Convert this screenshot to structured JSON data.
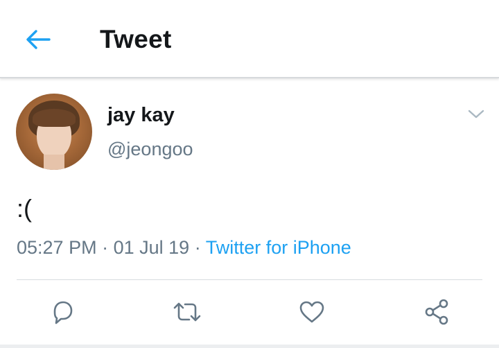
{
  "header": {
    "title": "Tweet",
    "back_icon": "back-arrow-icon"
  },
  "tweet": {
    "user": {
      "name": "jay kay",
      "handle": "@jeongoo",
      "avatar_icon": "profile-photo"
    },
    "more_icon": "chevron-down-icon",
    "text": ":(",
    "time": "05:27 PM",
    "date": "01 Jul 19",
    "separator": "·",
    "source": "Twitter for iPhone"
  },
  "actions": {
    "reply_icon": "reply-icon",
    "retweet_icon": "retweet-icon",
    "like_icon": "heart-icon",
    "share_icon": "share-icon"
  },
  "colors": {
    "accent": "#1da1f2",
    "text_primary": "#14171a",
    "text_secondary": "#657786",
    "icon_gray": "#657786"
  }
}
